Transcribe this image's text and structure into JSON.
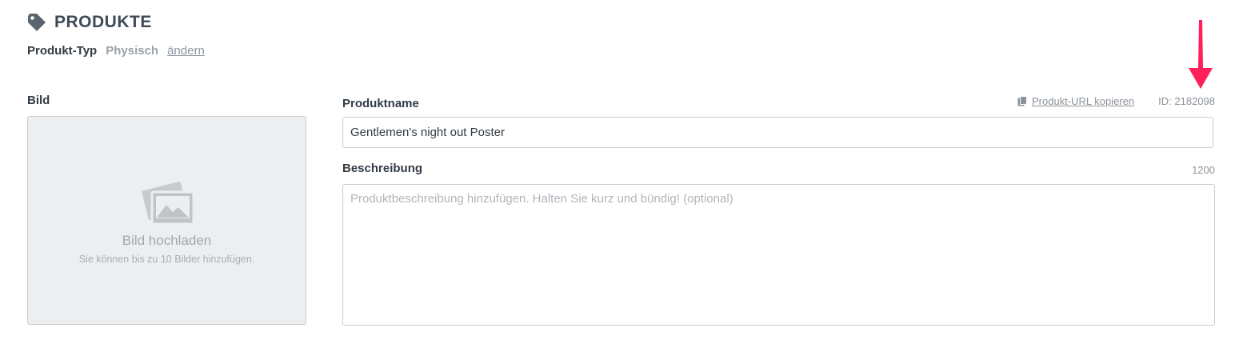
{
  "header": {
    "title": "PRODUKTE",
    "icon": "tag-icon"
  },
  "product_type": {
    "label": "Produkt-Typ",
    "value": "Physisch",
    "change_link": "ändern"
  },
  "image_section": {
    "label": "Bild",
    "upload_title": "Bild hochladen",
    "upload_hint": "Sie können bis zu 10 Bilder hinzufügen.",
    "icon": "images-icon"
  },
  "name_section": {
    "label": "Produktname",
    "copy_url_label": "Produkt-URL kopieren",
    "product_id": "ID: 2182098",
    "value": "Gentlemen's night out Poster"
  },
  "description_section": {
    "label": "Beschreibung",
    "char_count": "1200",
    "placeholder": "Produktbeschreibung hinzufügen. Halten Sie kurz und bündig! (optional)"
  },
  "colors": {
    "accent_arrow": "#ff1f5a",
    "label_dark": "#333b44",
    "muted": "#8b9299"
  }
}
